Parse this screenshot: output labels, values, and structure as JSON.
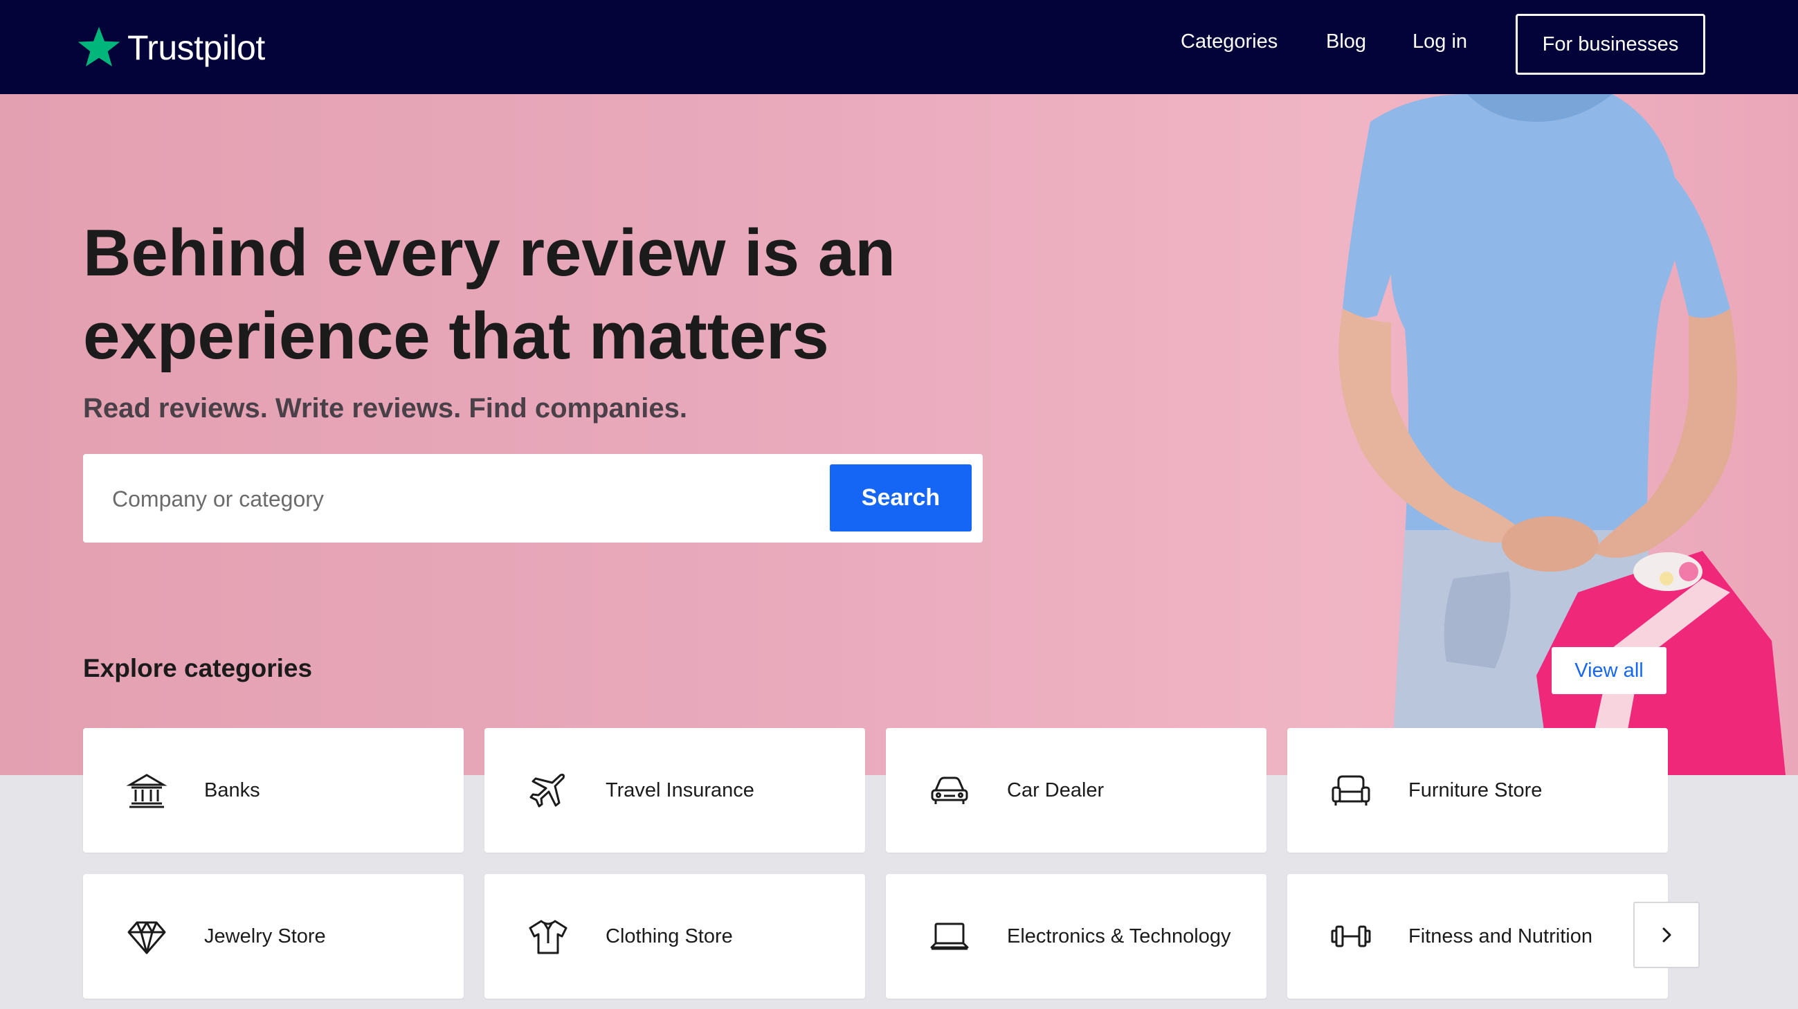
{
  "header": {
    "logo_text": "Trustpilot",
    "nav": [
      "Categories",
      "Blog",
      "Log in"
    ],
    "business_button": "For businesses"
  },
  "hero": {
    "title_line1": "Behind every review is an",
    "title_line2": "experience that matters",
    "subtitle": "Read reviews. Write reviews. Find companies.",
    "search_placeholder": "Company or category",
    "search_button": "Search"
  },
  "explore": {
    "title": "Explore categories",
    "view_all": "View all",
    "categories": [
      {
        "label": "Banks",
        "icon": "bank-icon"
      },
      {
        "label": "Travel Insurance",
        "icon": "airplane-icon"
      },
      {
        "label": "Car Dealer",
        "icon": "car-icon"
      },
      {
        "label": "Furniture Store",
        "icon": "armchair-icon"
      },
      {
        "label": "Jewelry Store",
        "icon": "diamond-icon"
      },
      {
        "label": "Clothing Store",
        "icon": "shirt-icon"
      },
      {
        "label": "Electronics & Technology",
        "icon": "laptop-icon"
      },
      {
        "label": "Fitness and Nutrition",
        "icon": "dumbbell-icon"
      }
    ]
  },
  "colors": {
    "header_bg": "#03033a",
    "logo_star": "#00b67a",
    "accent_blue": "#1666f5",
    "hero_pink": "#e9aabd"
  }
}
